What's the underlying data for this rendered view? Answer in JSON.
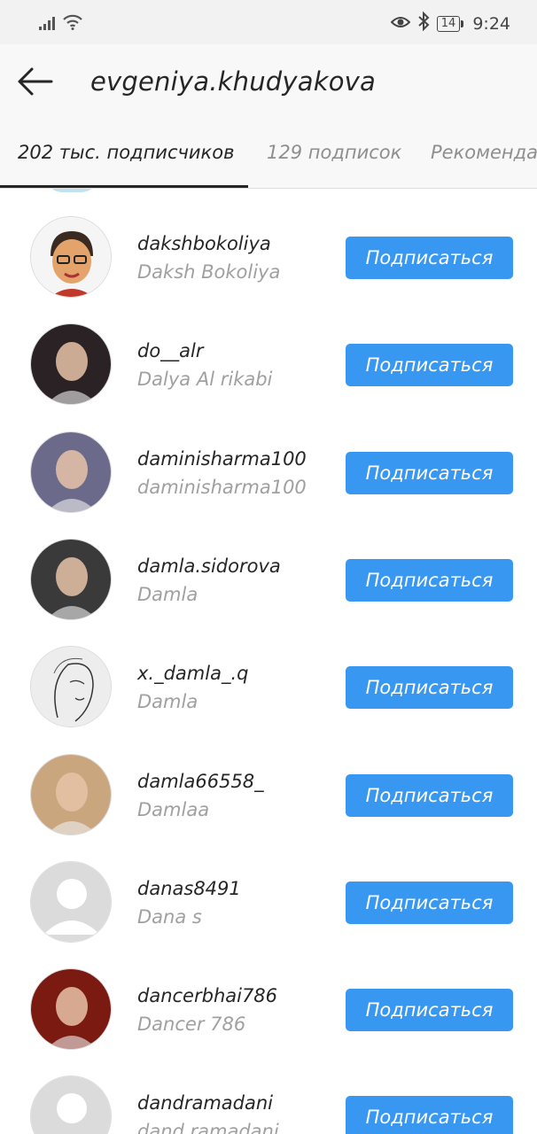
{
  "status_bar": {
    "signal": "signal-icon",
    "wifi": "wifi-icon",
    "eye": "eye-icon",
    "bluetooth": "bluetooth-icon",
    "battery": "14",
    "time": "9:24"
  },
  "header": {
    "title": "evgeniya.khudyakova",
    "back_icon": "back-arrow-icon"
  },
  "tabs": [
    {
      "label": "202 тыс. подписчиков",
      "active": true
    },
    {
      "label": "129 подписок",
      "active": false
    },
    {
      "label": "Рекомендации",
      "active": false
    }
  ],
  "follow_label": "Подписаться",
  "users": [
    {
      "username": "dakshbokoliya",
      "fullname": "Daksh Bokoliya",
      "avatar": "cartoon",
      "color": "#f5f5f5"
    },
    {
      "username": "do__alr",
      "fullname": "Dalya Al rikabi",
      "avatar": "photo",
      "color": "#2b2226"
    },
    {
      "username": "daminisharma100",
      "fullname": "daminisharma100",
      "avatar": "photo",
      "color": "#6b6a8a"
    },
    {
      "username": "damla.sidorova",
      "fullname": "Damla",
      "avatar": "photo",
      "color": "#3a3a3a"
    },
    {
      "username": "x._damla_.q",
      "fullname": "Damla",
      "avatar": "sketch",
      "color": "#ededed"
    },
    {
      "username": "damla66558_",
      "fullname": "Damlaa",
      "avatar": "photo",
      "color": "#c9a67e"
    },
    {
      "username": "danas8491",
      "fullname": "Dana s",
      "avatar": "default",
      "color": "#dbdbdb"
    },
    {
      "username": "dancerbhai786",
      "fullname": "Dancer 786",
      "avatar": "photo",
      "color": "#7a1a10"
    },
    {
      "username": "dandramadani",
      "fullname": "dand ramadani",
      "avatar": "default",
      "color": "#dbdbdb"
    }
  ]
}
